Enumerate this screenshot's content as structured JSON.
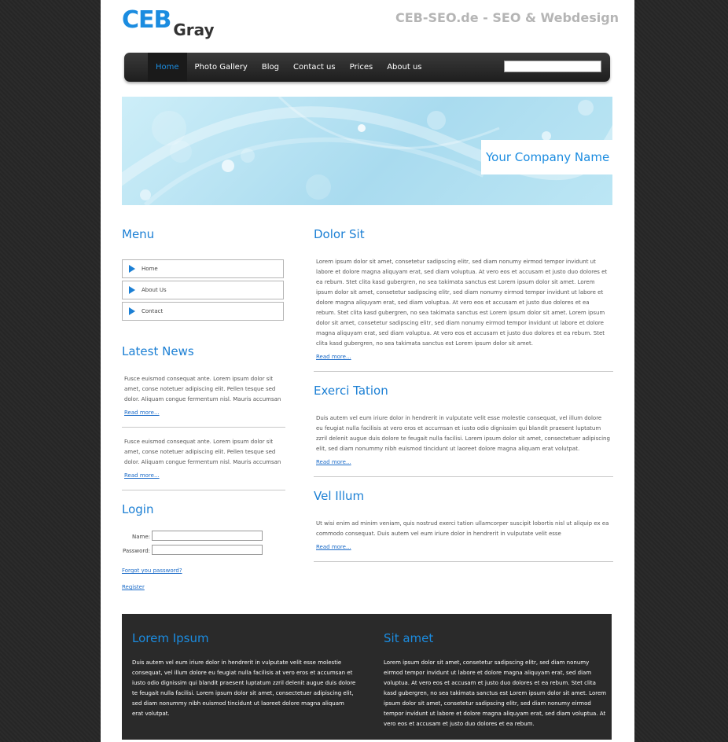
{
  "header": {
    "logo_main": "CEB",
    "logo_sub": "Gray",
    "tagline": "CEB-SEO.de - SEO & Webdesign"
  },
  "nav": {
    "items": [
      {
        "label": "Home"
      },
      {
        "label": "Photo Gallery"
      },
      {
        "label": "Blog"
      },
      {
        "label": "Contact us"
      },
      {
        "label": "Prices"
      },
      {
        "label": "About us"
      }
    ],
    "active_index": 0,
    "search_value": ""
  },
  "banner": {
    "company_name": "Your Company Name"
  },
  "sidebar": {
    "menu_title": "Menu",
    "menu_items": [
      {
        "label": "Home"
      },
      {
        "label": "About Us"
      },
      {
        "label": "Contact"
      }
    ],
    "news_title": "Latest News",
    "news": [
      {
        "text": "Fusce euismod consequat ante. Lorem ipsum dolor sit amet, conse notetuer adipiscing elit. Pellen tesque sed dolor. Aliquam congue fermentum nisl. Mauris accumsan",
        "read_more": "Read more..."
      },
      {
        "text": "Fusce euismod consequat ante. Lorem ipsum dolor sit amet, conse notetuer adipiscing elit. Pellen tesque sed dolor. Aliquam congue fermentum nisl. Mauris accumsan",
        "read_more": "Read more..."
      }
    ],
    "login": {
      "title": "Login",
      "name_label": "Name:",
      "password_label": "Password:",
      "name_value": "",
      "password_value": "",
      "forgot_link": "Forgot you password?",
      "register_link": "Register"
    }
  },
  "main": {
    "articles": [
      {
        "title": "Dolor Sit",
        "text": "Lorem ipsum dolor sit amet, consetetur sadipscing elitr, sed diam nonumy eirmod tempor invidunt ut labore et dolore magna aliquyam erat, sed diam voluptua. At vero eos et accusam et justo duo dolores et ea rebum. Stet clita kasd gubergren, no sea takimata sanctus est Lorem ipsum dolor sit amet. Lorem ipsum dolor sit amet, consetetur sadipscing elitr, sed diam nonumy eirmod tempor invidunt ut labore et dolore magna aliquyam erat, sed diam voluptua. At vero eos et accusam et justo duo dolores et ea rebum. Stet clita kasd gubergren, no sea takimata sanctus est Lorem ipsum dolor sit amet. Lorem ipsum dolor sit amet, consetetur sadipscing elitr, sed diam nonumy eirmod tempor invidunt ut labore et dolore magna aliquyam erat, sed diam voluptua. At vero eos et accusam et justo duo dolores et ea rebum. Stet clita kasd gubergren, no sea takimata sanctus est Lorem ipsum dolor sit amet.",
        "read_more": "Read more..."
      },
      {
        "title": "Exerci Tation",
        "text": "Duis autem vel eum iriure dolor in hendrerit in vulputate velit esse molestie consequat, vel illum dolore eu feugiat nulla facilisis at vero eros et accumsan et iusto odio dignissim qui blandit praesent luptatum zzril delenit augue duis dolore te feugait nulla facilisi. Lorem ipsum dolor sit amet, consectetuer adipiscing elit, sed diam nonummy nibh euismod tincidunt ut laoreet dolore magna aliquam erat volutpat.",
        "read_more": "Read more..."
      },
      {
        "title": "Vel Illum",
        "text": "Ut wisi enim ad minim veniam, quis nostrud exerci tation ullamcorper suscipit lobortis nisl ut aliquip ex ea commodo consequat. Duis autem vel eum iriure dolor in hendrerit in vulputate velit esse",
        "read_more": "Read more..."
      }
    ]
  },
  "footer": {
    "left_title": "Lorem Ipsum",
    "left_text": "Duis autem vel eum iriure dolor in hendrerit in vulputate velit esse molestie consequat, vel illum dolore eu feugiat nulla facilisis at vero eros et accumsan et iusto odio dignissim qui blandit praesent luptatum zzril delenit augue duis dolore te feugait nulla facilisi. Lorem ipsum dolor sit amet, consectetuer adipiscing elit, sed diam nonummy nibh euismod tincidunt ut laoreet dolore magna aliquam erat volutpat.",
    "right_title": "Sit amet",
    "right_text": "Lorem ipsum dolor sit amet, consetetur sadipscing elitr, sed diam nonumy eirmod tempor invidunt ut labore et dolore magna aliquyam erat, sed diam voluptua. At vero eos et accusam et justo duo dolores et ea rebum. Stet clita kasd gubergren, no sea takimata sanctus est Lorem ipsum dolor sit amet. Lorem ipsum dolor sit amet, consetetur sadipscing elitr, sed diam nonumy eirmod tempor invidunt ut labore et dolore magna aliquyam erat, sed diam voluptua. At vero eos et accusam et justo duo dolores et ea rebum."
  },
  "colors": {
    "accent": "#1b8ce0",
    "background": "#262626",
    "footer_bg": "#2a2a2a"
  }
}
